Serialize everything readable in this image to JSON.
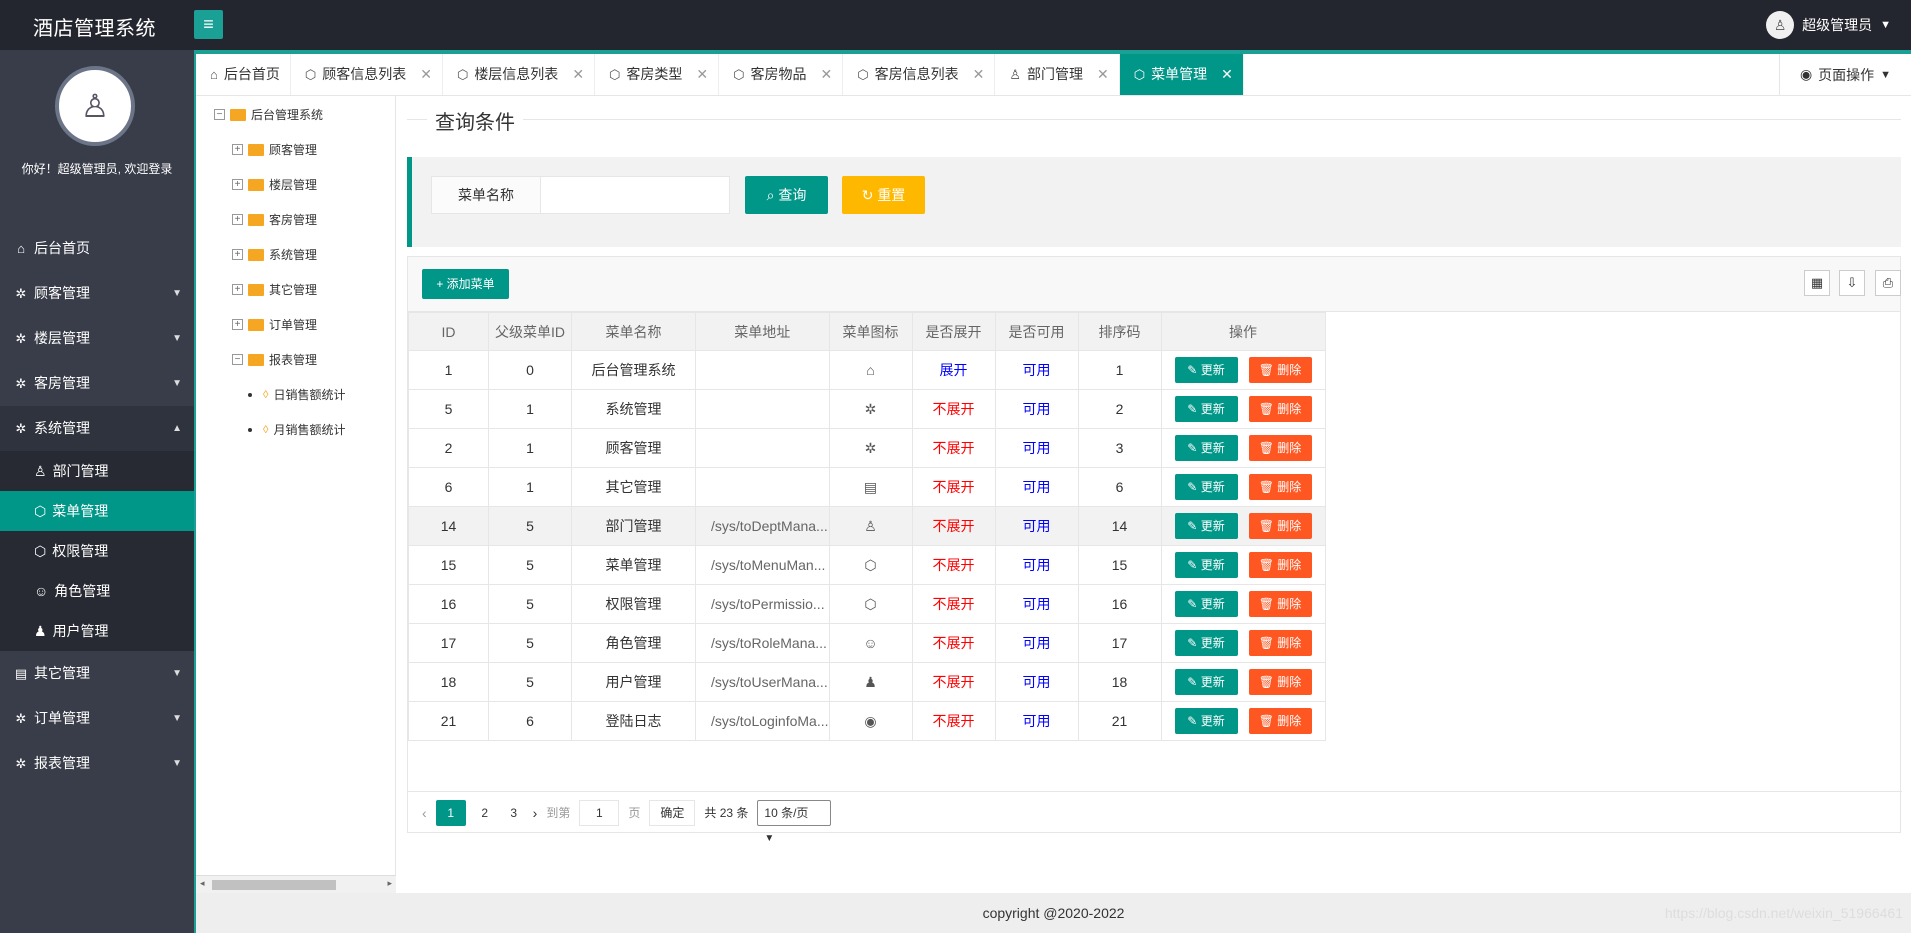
{
  "app": {
    "title": "酒店管理系统",
    "menu_toggle_icon": "≡"
  },
  "user": {
    "name": "超级管理员",
    "greeting": "你好！超级管理员, 欢迎登录"
  },
  "sidebar": {
    "items": [
      {
        "label": "后台首页",
        "icon": "home-icon"
      },
      {
        "label": "顾客管理",
        "icon": "gear-icon"
      },
      {
        "label": "楼层管理",
        "icon": "gear-icon"
      },
      {
        "label": "客房管理",
        "icon": "gear-icon"
      },
      {
        "label": "系统管理",
        "icon": "gear-icon"
      },
      {
        "label": "其它管理",
        "icon": "clipboard-icon"
      },
      {
        "label": "订单管理",
        "icon": "gear-icon"
      },
      {
        "label": "报表管理",
        "icon": "gear-icon"
      }
    ],
    "sub": [
      {
        "label": "部门管理",
        "icon": "user-outline-icon"
      },
      {
        "label": "菜单管理",
        "icon": "cube-icon"
      },
      {
        "label": "权限管理",
        "icon": "cube-icon"
      },
      {
        "label": "角色管理",
        "icon": "smile-icon"
      },
      {
        "label": "用户管理",
        "icon": "user-icon"
      }
    ]
  },
  "tabs": [
    {
      "label": "后台首页",
      "icon": "home-icon"
    },
    {
      "label": "顾客信息列表",
      "icon": "cube-icon"
    },
    {
      "label": "楼层信息列表",
      "icon": "cube-icon"
    },
    {
      "label": "客房类型",
      "icon": "cube-icon"
    },
    {
      "label": "客房物品",
      "icon": "cube-icon"
    },
    {
      "label": "客房信息列表",
      "icon": "cube-icon"
    },
    {
      "label": "部门管理",
      "icon": "user-outline-icon"
    },
    {
      "label": "菜单管理",
      "icon": "cube-icon"
    }
  ],
  "tab_close": "✕",
  "page_ops": "页面操作",
  "tree": {
    "root": "后台管理系统",
    "nodes": [
      "顾客管理",
      "楼层管理",
      "客房管理",
      "系统管理",
      "其它管理",
      "订单管理",
      "报表管理"
    ],
    "leaves": [
      "日销售额统计",
      "月销售额统计"
    ]
  },
  "query": {
    "legend": "查询条件",
    "label": "菜单名称",
    "input_value": "",
    "search_label": "查询",
    "reset_label": "重置"
  },
  "table": {
    "add_label": "添加菜单",
    "headers": [
      "ID",
      "父级菜单ID",
      "菜单名称",
      "菜单地址",
      "菜单图标",
      "是否展开",
      "是否可用",
      "排序码",
      "操作"
    ],
    "update_label": "更新",
    "delete_label": "删除",
    "rows": [
      {
        "id": "1",
        "pid": "0",
        "name": "后台管理系统",
        "url": "",
        "icon": "home-icon",
        "glyph": "⌂",
        "spread": "展开",
        "avail": "可用",
        "order": "1"
      },
      {
        "id": "5",
        "pid": "1",
        "name": "系统管理",
        "url": "",
        "icon": "gear-icon",
        "glyph": "✲",
        "spread": "不展开",
        "avail": "可用",
        "order": "2"
      },
      {
        "id": "2",
        "pid": "1",
        "name": "顾客管理",
        "url": "",
        "icon": "gear-icon",
        "glyph": "✲",
        "spread": "不展开",
        "avail": "可用",
        "order": "3"
      },
      {
        "id": "6",
        "pid": "1",
        "name": "其它管理",
        "url": "",
        "icon": "clipboard-icon",
        "glyph": "▤",
        "spread": "不展开",
        "avail": "可用",
        "order": "6"
      },
      {
        "id": "14",
        "pid": "5",
        "name": "部门管理",
        "url": "/sys/toDeptMana...",
        "icon": "user-outline-icon",
        "glyph": "♙",
        "spread": "不展开",
        "avail": "可用",
        "order": "14"
      },
      {
        "id": "15",
        "pid": "5",
        "name": "菜单管理",
        "url": "/sys/toMenuMan...",
        "icon": "cube-icon",
        "glyph": "⬡",
        "spread": "不展开",
        "avail": "可用",
        "order": "15"
      },
      {
        "id": "16",
        "pid": "5",
        "name": "权限管理",
        "url": "/sys/toPermissio...",
        "icon": "cube-icon",
        "glyph": "⬡",
        "spread": "不展开",
        "avail": "可用",
        "order": "16"
      },
      {
        "id": "17",
        "pid": "5",
        "name": "角色管理",
        "url": "/sys/toRoleMana...",
        "icon": "smile-icon",
        "glyph": "☺",
        "spread": "不展开",
        "avail": "可用",
        "order": "17"
      },
      {
        "id": "18",
        "pid": "5",
        "name": "用户管理",
        "url": "/sys/toUserMana...",
        "icon": "user-icon",
        "glyph": "♟",
        "spread": "不展开",
        "avail": "可用",
        "order": "18"
      },
      {
        "id": "21",
        "pid": "6",
        "name": "登陆日志",
        "url": "/sys/toLoginfoMa...",
        "icon": "weibo-icon",
        "glyph": "◉",
        "spread": "不展开",
        "avail": "可用",
        "order": "21"
      }
    ]
  },
  "pager": {
    "current": "1",
    "pages": [
      "2",
      "3"
    ],
    "goto_label": "到第",
    "goto_value": "1",
    "page_suffix": "页",
    "confirm": "确定",
    "total": "共 23 条",
    "size": "10 条/页"
  },
  "footer": "copyright @2020-2022",
  "watermark": "https://blog.csdn.net/weixin_51966461",
  "colors": {
    "accent": "#009688",
    "warning": "#ffb800",
    "danger": "#ff5722",
    "dark": "#23262e",
    "sidebar": "#393d49"
  }
}
